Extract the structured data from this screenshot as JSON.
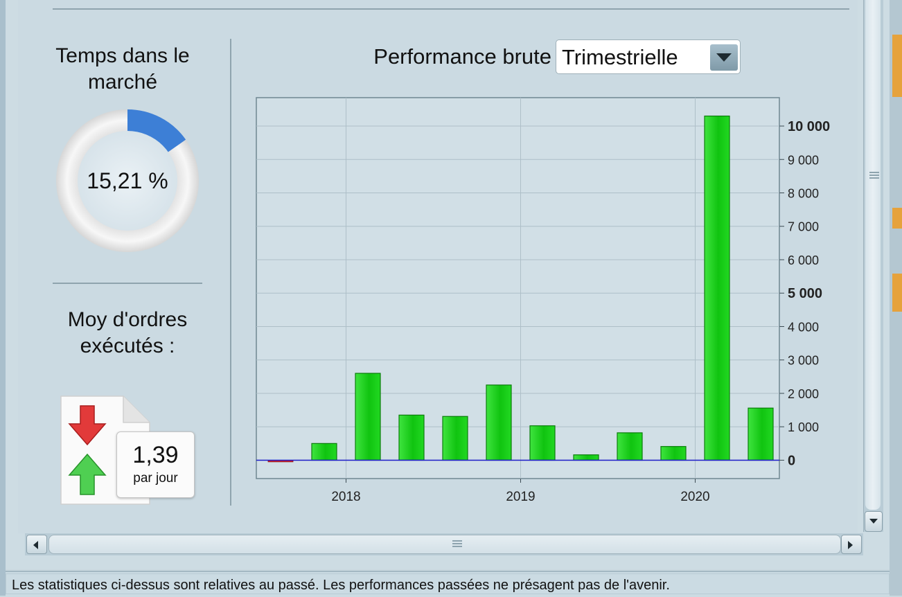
{
  "time_in_market": {
    "title": "Temps dans le marché",
    "value_label": "15,21 %",
    "fraction": 0.1521
  },
  "orders": {
    "title": "Moy d'ordres exécutés :",
    "value": "1,39",
    "unit": "par jour"
  },
  "performance": {
    "label": "Performance brute",
    "period_selected": "Trimestrielle"
  },
  "chart_data": {
    "type": "bar",
    "title": "",
    "xlabel": "",
    "ylabel": "",
    "x_ticks": [
      "2018",
      "2019",
      "2020"
    ],
    "y_ticks": [
      "0",
      "1 000",
      "2 000",
      "3 000",
      "4 000",
      "5 000",
      "6 000",
      "7 000",
      "8 000",
      "9 000",
      "10 000"
    ],
    "bold_y_ticks": [
      "0",
      "5 000",
      "10 000"
    ],
    "ylim": [
      -550,
      10850
    ],
    "grid": true,
    "y_axis_side": "right",
    "categories": [
      "2017-T3",
      "2017-T4",
      "2018-T1",
      "2018-T2",
      "2018-T3",
      "2018-T4",
      "2019-T1",
      "2019-T2",
      "2019-T3",
      "2019-T4",
      "2020-T1",
      "2020-T2"
    ],
    "values": [
      -50,
      500,
      2600,
      1350,
      1310,
      2250,
      1030,
      160,
      820,
      410,
      10300,
      1560
    ],
    "colors": {
      "positive": "#1ecf1e",
      "negative": "#d4202c",
      "zero_line": "#1c1cc8"
    }
  },
  "status_bar": {
    "text": "Les statistiques ci-dessus sont relatives au passé. Les performances passées ne présagent pas de l'avenir."
  }
}
